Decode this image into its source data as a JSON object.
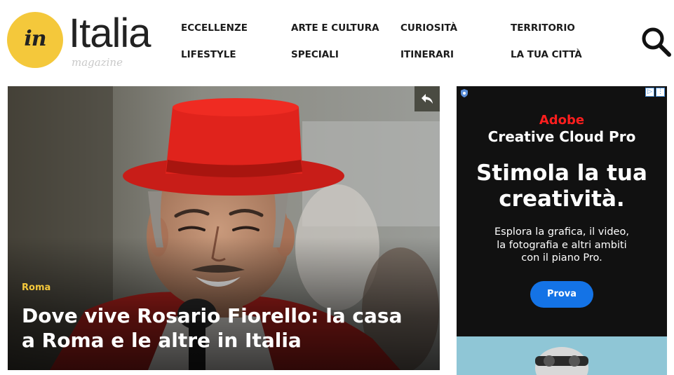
{
  "header": {
    "logo_mark": "in",
    "logo_word": "Italia",
    "logo_tag": "magazine"
  },
  "nav": [
    {
      "label": "ECCELLENZE"
    },
    {
      "label": "ARTE E CULTURA"
    },
    {
      "label": "CURIOSITÀ"
    },
    {
      "label": "TERRITORIO"
    },
    {
      "label": "LIFESTYLE"
    },
    {
      "label": "SPECIALI"
    },
    {
      "label": "ITINERARI"
    },
    {
      "label": "LA TUA CITTÀ"
    }
  ],
  "hero": {
    "category": "Roma",
    "title": "Dove vive Rosario Fiorello: la casa a Roma e le altre in Italia"
  },
  "ad": {
    "brand": "Adobe",
    "product": "Creative Cloud Pro",
    "headline_line1": "Stimola la tua",
    "headline_line2": "creatività.",
    "body_line1": "Esplora la grafica, il video,",
    "body_line2": "la fotografia e altri ambiti",
    "body_line3": "con il piano Pro.",
    "cta": "Prova"
  },
  "colors": {
    "accent_yellow": "#f4c83b",
    "ad_brand_red": "#ff1e1e",
    "ad_button_blue": "#1473e6"
  }
}
